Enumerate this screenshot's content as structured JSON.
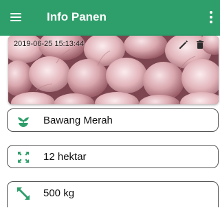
{
  "appbar": {
    "title": "Info Panen",
    "bg_color": "#2e9e6a",
    "menu_icon": "hamburger-menu-icon",
    "more_icon": "more-vert-icon"
  },
  "photo": {
    "timestamp": "2019-06-25 15:13:44",
    "subject": "shallots",
    "edit_icon": "pencil-icon",
    "delete_icon": "trash-icon"
  },
  "rows": [
    {
      "text": "Bawang Merah",
      "icon": "sprout-icon"
    },
    {
      "text": "12 hektar",
      "icon": "expand-arrows-icon"
    },
    {
      "text": "500 kg",
      "icon": "diagonal-arrow-icon"
    }
  ],
  "colors": {
    "accent": "#2e9e6a",
    "border": "#555555"
  }
}
